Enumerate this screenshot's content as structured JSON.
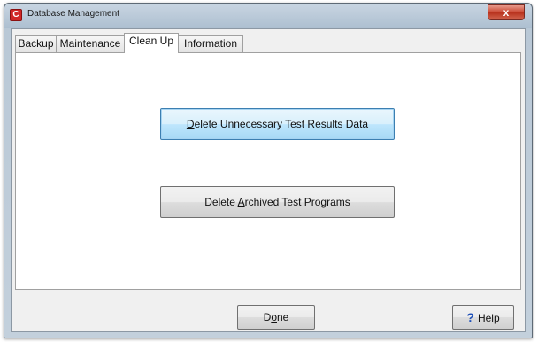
{
  "window": {
    "title": "Database Management",
    "app_icon_glyph": "C",
    "close_glyph": "x"
  },
  "tabs": [
    {
      "label": "Backup",
      "active": false
    },
    {
      "label": "Maintenance",
      "active": false
    },
    {
      "label": "Clean Up",
      "active": true
    },
    {
      "label": "Information",
      "active": false
    }
  ],
  "cleanup": {
    "delete_results": {
      "pre": "",
      "key": "D",
      "post": "elete Unnecessary Test Results Data"
    },
    "delete_archived": {
      "pre": "Delete ",
      "key": "A",
      "post": "rchived Test Programs"
    }
  },
  "footer": {
    "done": {
      "pre": "D",
      "key": "o",
      "post": "ne"
    },
    "help": {
      "icon_glyph": "?",
      "pre": "",
      "key": "H",
      "post": "elp"
    }
  },
  "icons": [
    "app-icon",
    "close-icon",
    "help-question-icon"
  ],
  "colors": {
    "accent": "#3c7fb1",
    "help_icon": "#1d4fb8",
    "close_button": "#c94530"
  }
}
